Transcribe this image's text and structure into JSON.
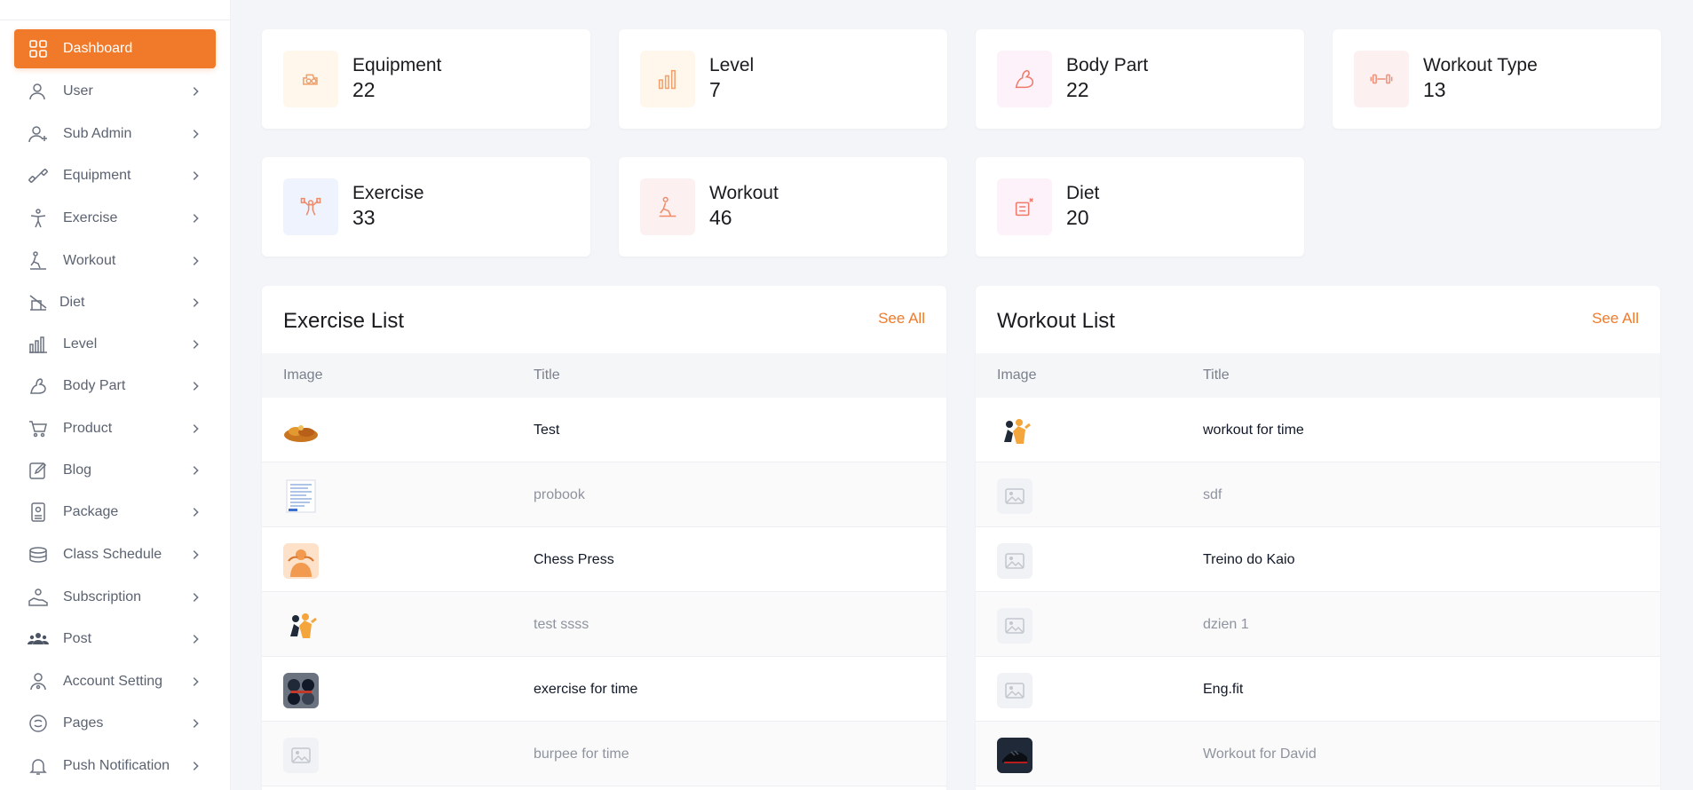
{
  "sidebar": {
    "items": [
      {
        "label": "Dashboard",
        "icon": "dashboard-icon"
      },
      {
        "label": "User",
        "icon": "user-icon"
      },
      {
        "label": "Sub Admin",
        "icon": "user-plus-icon"
      },
      {
        "label": "Equipment",
        "icon": "dumbbell-icon"
      },
      {
        "label": "Exercise",
        "icon": "person-exercise-icon"
      },
      {
        "label": "Workout",
        "icon": "workout-icon"
      },
      {
        "label": "Diet",
        "icon": "diet-icon"
      },
      {
        "label": "Level",
        "icon": "bar-chart-icon"
      },
      {
        "label": "Body Part",
        "icon": "body-part-icon"
      },
      {
        "label": "Product",
        "icon": "cart-icon"
      },
      {
        "label": "Blog",
        "icon": "edit-icon"
      },
      {
        "label": "Package",
        "icon": "package-icon"
      },
      {
        "label": "Class Schedule",
        "icon": "schedule-icon"
      },
      {
        "label": "Subscription",
        "icon": "subscription-icon"
      },
      {
        "label": "Post",
        "icon": "group-icon"
      },
      {
        "label": "Account Setting",
        "icon": "account-icon"
      },
      {
        "label": "Pages",
        "icon": "pages-icon"
      },
      {
        "label": "Push Notification",
        "icon": "bell-icon"
      }
    ]
  },
  "stats": [
    {
      "label": "Equipment",
      "value": "22",
      "icon": "equipment-icon"
    },
    {
      "label": "Level",
      "value": "7",
      "icon": "level-icon"
    },
    {
      "label": "Body Part",
      "value": "22",
      "icon": "body-part-icon"
    },
    {
      "label": "Workout Type",
      "value": "13",
      "icon": "workout-type-icon"
    },
    {
      "label": "Exercise",
      "value": "33",
      "icon": "exercise-icon"
    },
    {
      "label": "Workout",
      "value": "46",
      "icon": "workout-icon"
    },
    {
      "label": "Diet",
      "value": "20",
      "icon": "diet-icon"
    }
  ],
  "exercise_list": {
    "title": "Exercise List",
    "see_all": "See All",
    "columns": [
      "Image",
      "Title"
    ],
    "rows": [
      {
        "title": "Test",
        "image": "food-image"
      },
      {
        "title": "probook",
        "image": "document-image"
      },
      {
        "title": "Chess Press",
        "image": "athlete-image"
      },
      {
        "title": "test ssss",
        "image": "fitness-image"
      },
      {
        "title": "exercise for time",
        "image": "dumbbells-image"
      },
      {
        "title": "burpee for time",
        "image": "placeholder-image"
      }
    ]
  },
  "workout_list": {
    "title": "Workout List",
    "see_all": "See All",
    "columns": [
      "Image",
      "Title"
    ],
    "rows": [
      {
        "title": "workout for time",
        "image": "fitness-image"
      },
      {
        "title": "sdf",
        "image": "placeholder-image"
      },
      {
        "title": "Treino do Kaio",
        "image": "placeholder-image"
      },
      {
        "title": "dzien 1",
        "image": "placeholder-image"
      },
      {
        "title": "Eng.fit",
        "image": "placeholder-image"
      },
      {
        "title": "Workout for David",
        "image": "shoe-image"
      }
    ]
  },
  "colors": {
    "accent": "#f07a2a",
    "background": "#f4f5f9"
  }
}
